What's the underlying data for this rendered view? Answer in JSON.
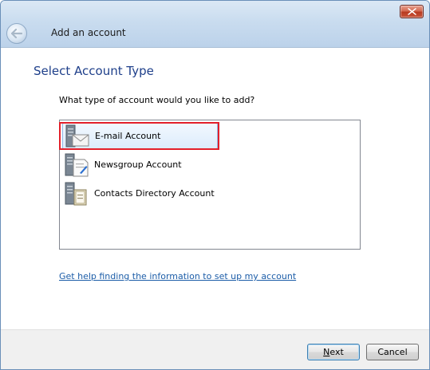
{
  "window": {
    "title": "Add an account"
  },
  "page": {
    "heading": "Select Account Type",
    "question": "What type of account would you like to add?",
    "help_link": "Get help finding the information to set up my account"
  },
  "account_types": [
    {
      "label": "E-mail Account",
      "icon": "email-server-icon",
      "selected": true
    },
    {
      "label": "Newsgroup Account",
      "icon": "newsgroup-server-icon",
      "selected": false
    },
    {
      "label": "Contacts Directory Account",
      "icon": "directory-server-icon",
      "selected": false
    }
  ],
  "buttons": {
    "next_mnemonic": "N",
    "next_rest": "ext",
    "cancel": "Cancel"
  },
  "colors": {
    "heading": "#1e3f8a",
    "link": "#1c5da8",
    "highlight": "#e3202a"
  }
}
